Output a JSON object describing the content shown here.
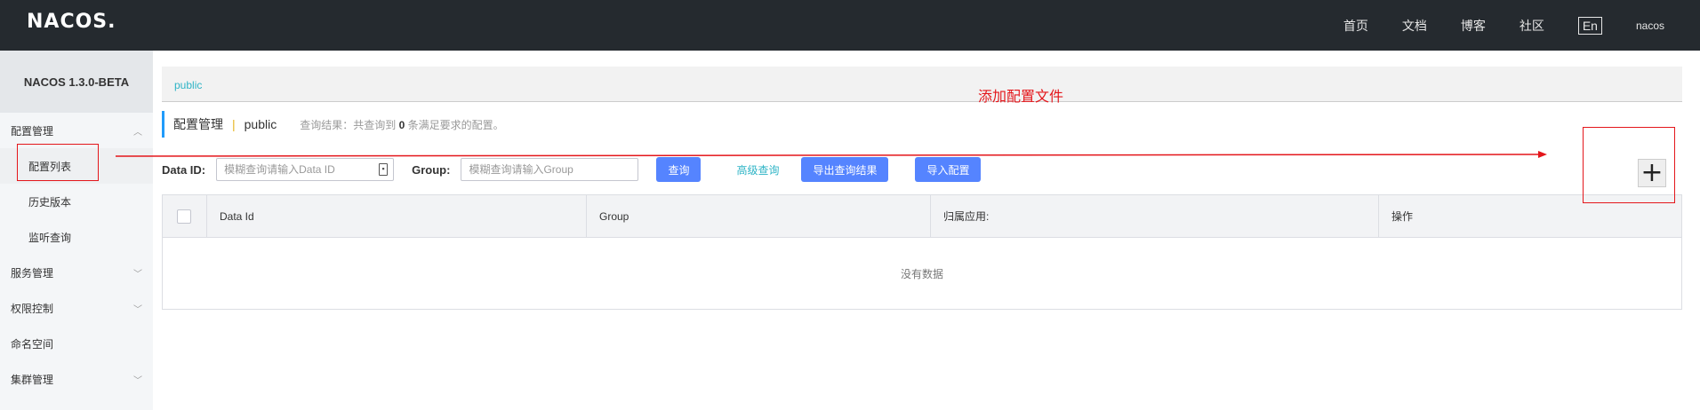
{
  "header": {
    "logo": "NACOS.",
    "nav": [
      "首页",
      "文档",
      "博客",
      "社区"
    ],
    "lang": "En",
    "user": "nacos"
  },
  "sidebar": {
    "version": "NACOS 1.3.0-BETA",
    "groups": [
      {
        "label": "配置管理",
        "expanded": true,
        "items": [
          "配置列表",
          "历史版本",
          "监听查询"
        ]
      },
      {
        "label": "服务管理"
      },
      {
        "label": "权限控制"
      },
      {
        "label": "命名空间"
      },
      {
        "label": "集群管理"
      }
    ]
  },
  "main": {
    "namespace": "public",
    "title": "配置管理",
    "separator": "|",
    "subtitle": "public",
    "result_prefix": "查询结果：共查询到",
    "result_count": "0",
    "result_suffix": "条满足要求的配置。",
    "annotation": "添加配置文件",
    "filter": {
      "data_id_label": "Data ID:",
      "data_id_placeholder": "模糊查询请输入Data ID",
      "group_label": "Group:",
      "group_placeholder": "模糊查询请输入Group",
      "query_button": "查询",
      "advanced_link": "高级查询",
      "export_button": "导出查询结果",
      "import_button": "导入配置"
    },
    "table": {
      "columns": [
        "Data Id",
        "Group",
        "归属应用:",
        "操作"
      ],
      "empty_text": "没有数据"
    },
    "plus_label": "+"
  },
  "colors": {
    "topbar": "#252a2f",
    "primary": "#5584ff",
    "link": "#2fb4c6",
    "annotation": "#e4161b"
  }
}
